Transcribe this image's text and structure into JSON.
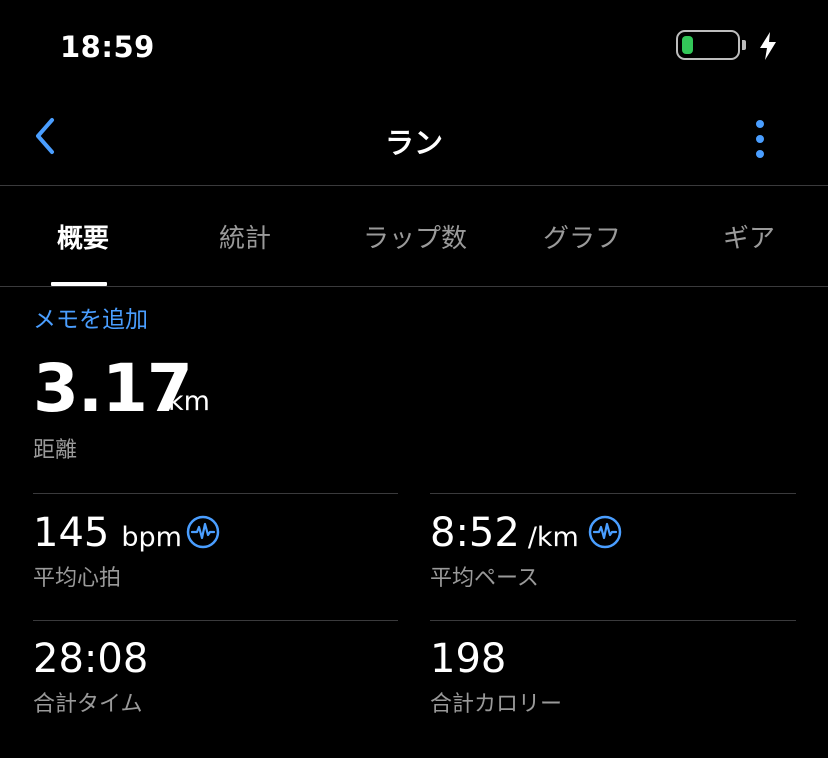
{
  "status_bar": {
    "time": "18:59",
    "battery_color": "#33c759",
    "battery_level": 0.2,
    "charging": true
  },
  "nav": {
    "back_icon": "chevron-left-icon",
    "title": "ラン",
    "more_icon": "more-vertical-icon",
    "accent_color": "#4a9eff"
  },
  "tabs": [
    {
      "label": "概要",
      "active": true
    },
    {
      "label": "統計",
      "active": false
    },
    {
      "label": "ラップ数",
      "active": false
    },
    {
      "label": "グラフ",
      "active": false
    },
    {
      "label": "ギア",
      "active": false
    }
  ],
  "summary": {
    "add_note": "メモを追加",
    "distance": {
      "value": "3.17",
      "unit": "km",
      "label": "距離"
    },
    "heart_rate": {
      "value": "145",
      "unit": "bpm",
      "label": "平均心拍",
      "icon": "heart-rate-icon"
    },
    "pace": {
      "value": "8:52",
      "unit": "/km",
      "label": "平均ペース",
      "icon": "heart-rate-icon"
    },
    "total_time": {
      "value": "28:08",
      "label": "合計タイム"
    },
    "calories": {
      "value": "198",
      "label": "合計カロリー"
    }
  }
}
